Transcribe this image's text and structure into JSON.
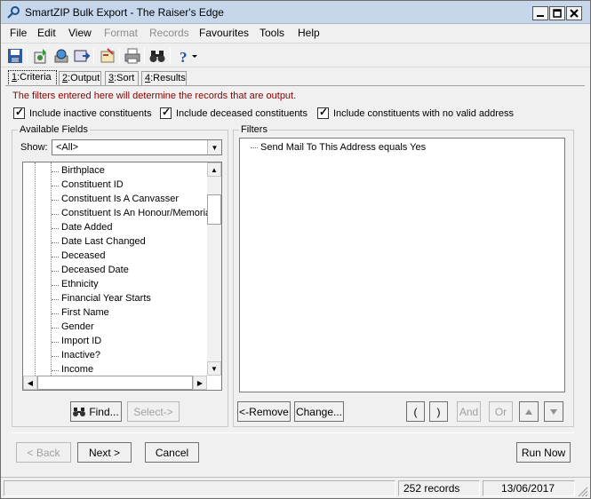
{
  "window": {
    "title": "SmartZIP Bulk Export - The Raiser's Edge"
  },
  "menu": [
    "File",
    "Edit",
    "View",
    "Format",
    "Records",
    "Favourites",
    "Tools",
    "Help"
  ],
  "menu_disabled": [
    "Format",
    "Records"
  ],
  "tabs": [
    {
      "key": "1",
      "label": ":Criteria"
    },
    {
      "key": "2",
      "label": ":Output"
    },
    {
      "key": "3",
      "label": ":Sort"
    },
    {
      "key": "4",
      "label": ":Results"
    }
  ],
  "info_text": "The filters entered here will determine the records that are output.",
  "checkboxes": {
    "inactive": "Include inactive constituents",
    "deceased": "Include deceased constituents",
    "no_address": "Include constituents with no valid address"
  },
  "available_fields": {
    "label": "Available Fields",
    "show_label": "Show:",
    "show_value": "<All>",
    "items": [
      "Birthplace",
      "Constituent ID",
      "Constituent Is A Canvasser",
      "Constituent Is An Honour/Memoria",
      "Date Added",
      "Date Last Changed",
      "Deceased",
      "Deceased Date",
      "Ethnicity",
      "Financial Year Starts",
      "First Name",
      "Gender",
      "Import ID",
      "Inactive?",
      "Income"
    ],
    "find_button": "Find...",
    "select_button": "Select->"
  },
  "filters": {
    "label": "Filters",
    "items": [
      "Send Mail To This Address equals Yes"
    ],
    "remove_button": "<-Remove",
    "change_button": "Change...",
    "open_paren": "(",
    "close_paren": ")",
    "and_button": "And",
    "or_button": "Or"
  },
  "nav": {
    "back": "< Back",
    "next": "Next >",
    "cancel": "Cancel",
    "run": "Run Now"
  },
  "status": {
    "records": "252 records",
    "date": "13/06/2017"
  }
}
